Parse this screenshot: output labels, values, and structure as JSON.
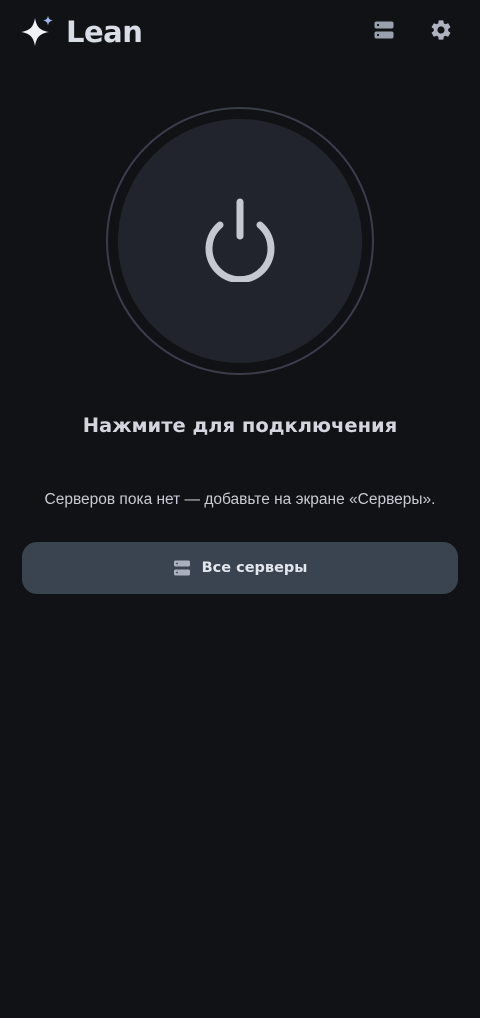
{
  "header": {
    "app_title": "Lean",
    "logo_icon": "sparkle-icon",
    "servers_icon": "servers-icon",
    "settings_icon": "gear-icon"
  },
  "main": {
    "power_icon": "power-icon",
    "connect_label": "Нажмите для подключения",
    "empty_hint": "Серверов пока нет — добавьте на экране «Серверы».",
    "all_servers_button": {
      "label": "Все серверы",
      "icon": "servers-icon"
    }
  },
  "colors": {
    "background": "#111216",
    "disc": "#22242d",
    "ring": "#3a3d4a",
    "button": "#3a4450",
    "accent_star": "#9db6e6",
    "text": "#d7dae2"
  }
}
